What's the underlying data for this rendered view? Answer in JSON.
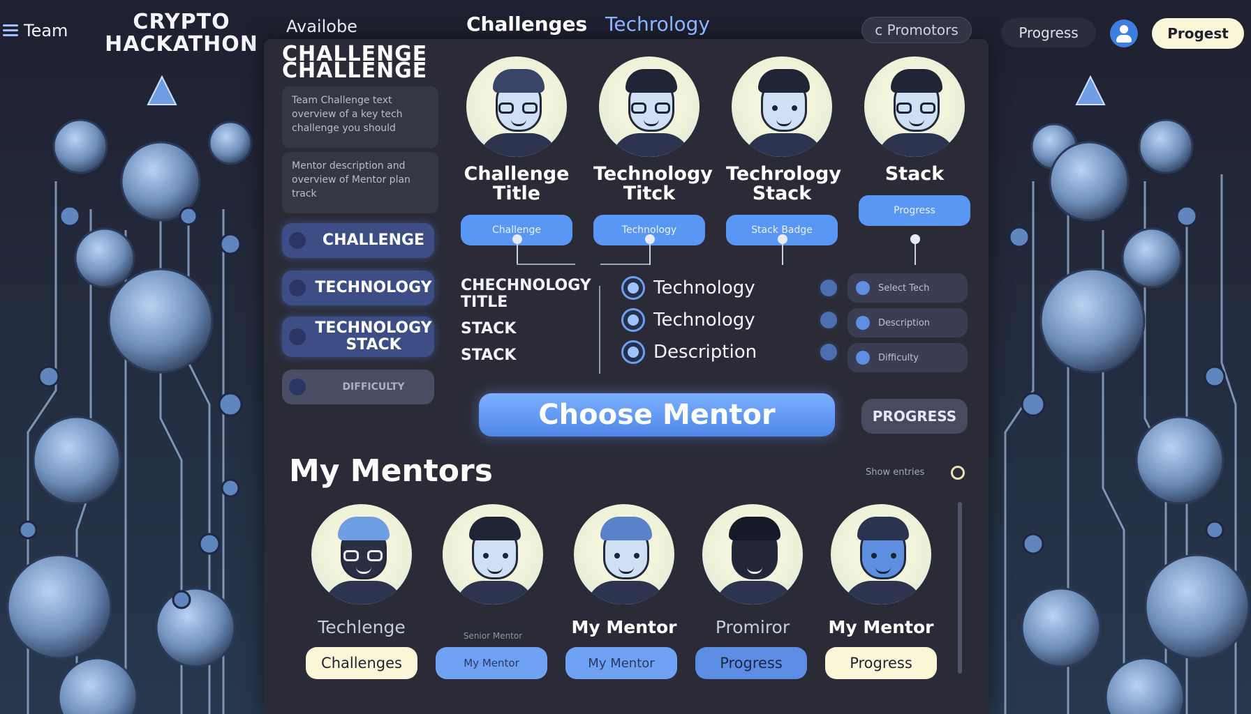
{
  "header": {
    "menu_label": "Team",
    "logo_line1": "CRYPTO",
    "logo_line2": "HACKATHON",
    "available_label": "Availobe",
    "tabs": [
      "Challenges",
      "Techrology"
    ],
    "promotors_pill": "c Promotors",
    "progress_pill": "Progress",
    "progest_button": "Progest"
  },
  "sidebar": {
    "challenge_title_1": "CHALLENGE",
    "challenge_title_2": "CHALLENGE",
    "card1_text": "Team Challenge text overview of a key tech challenge you should",
    "card2_text": "Mentor description and overview of Mentor plan track",
    "buttons": [
      "CHALLENGE",
      "TECHNOLOGY",
      "TECHNOLOGY STACK",
      "DIFFICULTY"
    ]
  },
  "top_mentors": [
    {
      "name": "Challenge Title",
      "button": "Challenge"
    },
    {
      "name": "Technology Titck",
      "button": "Technology"
    },
    {
      "name": "Techrology Stack",
      "button": "Stack Badge"
    },
    {
      "name": "Stack",
      "button": "Progress"
    }
  ],
  "tech_list": {
    "left_labels": [
      "CHECHNOLOGY",
      "TITLE",
      "STACK",
      "STACK"
    ],
    "items": [
      "Technology",
      "Technology",
      "Description"
    ],
    "right_items": [
      "Select Tech",
      "Description",
      "Difficulty"
    ]
  },
  "actions": {
    "choose_mentor": "Choose Mentor",
    "progress": "PROGRESS"
  },
  "my_mentors": {
    "heading": "My Mentors",
    "meta_text": "Show entries",
    "mentors": [
      {
        "name": "Techlenge",
        "button": "Challenges"
      },
      {
        "name": "Senior Mentor",
        "button": "My Mentor"
      },
      {
        "name": "My Mentor",
        "button": "My Mentor"
      },
      {
        "name": "Promiror",
        "button": "Progress"
      },
      {
        "name": "My Mentor",
        "button": "Progress"
      }
    ]
  },
  "colors": {
    "accent": "#5a96f3",
    "panel": "#2a2b37",
    "cream": "#fbf6d8"
  }
}
